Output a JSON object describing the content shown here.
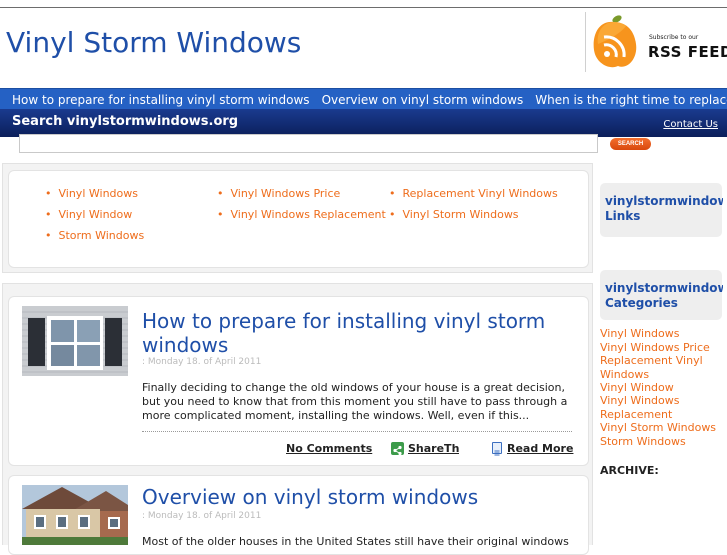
{
  "site": {
    "title": "Vinyl Storm Windows"
  },
  "rss": {
    "subscribe": "Subscribe to our",
    "feed": "RSS FEED"
  },
  "nav": [
    "How to prepare for installing vinyl storm windows",
    "Overview on vinyl storm windows",
    "When is the right time to replace your old"
  ],
  "search": {
    "title": "Search vinylstormwindows.org",
    "button": "SEARCH",
    "placeholder": "",
    "contact": "Contact Us"
  },
  "keywords": [
    "Vinyl Windows",
    "Vinyl Window",
    "Storm Windows",
    "Vinyl Windows Price",
    "Vinyl Windows Replacement",
    "Replacement Vinyl Windows",
    "Vinyl Storm Windows"
  ],
  "posts": [
    {
      "title": "How to prepare for installing vinyl storm windows",
      "date": ": Monday 18. of April 2011",
      "excerpt": "Finally deciding to change the old windows of your house is a great decision, but you need to know that from this moment you still have to pass through a more complicated moment, installing the windows. Well, even if this...",
      "comments": "No Comments",
      "share": "ShareThis",
      "read_more": "Read More"
    },
    {
      "title": "Overview on vinyl storm windows",
      "date": ": Monday 18. of April 2011",
      "excerpt": "Most of the older houses in the United States still have their original windows and"
    }
  ],
  "sidebar": {
    "links_heading": "vinylstormwindows.org Links",
    "categories_heading": "vinylstormwindows.org Categories",
    "categories": [
      "Vinyl Windows",
      "Vinyl Windows Price",
      "Replacement Vinyl Windows",
      "Vinyl Window",
      "Vinyl Windows Replacement",
      "Vinyl Storm Windows",
      "Storm Windows"
    ],
    "archive": "ARCHIVE:"
  },
  "colors": {
    "brand_blue": "#1f4fa8",
    "nav_blue": "#2561c4",
    "accent_orange": "#ee6d1c"
  }
}
